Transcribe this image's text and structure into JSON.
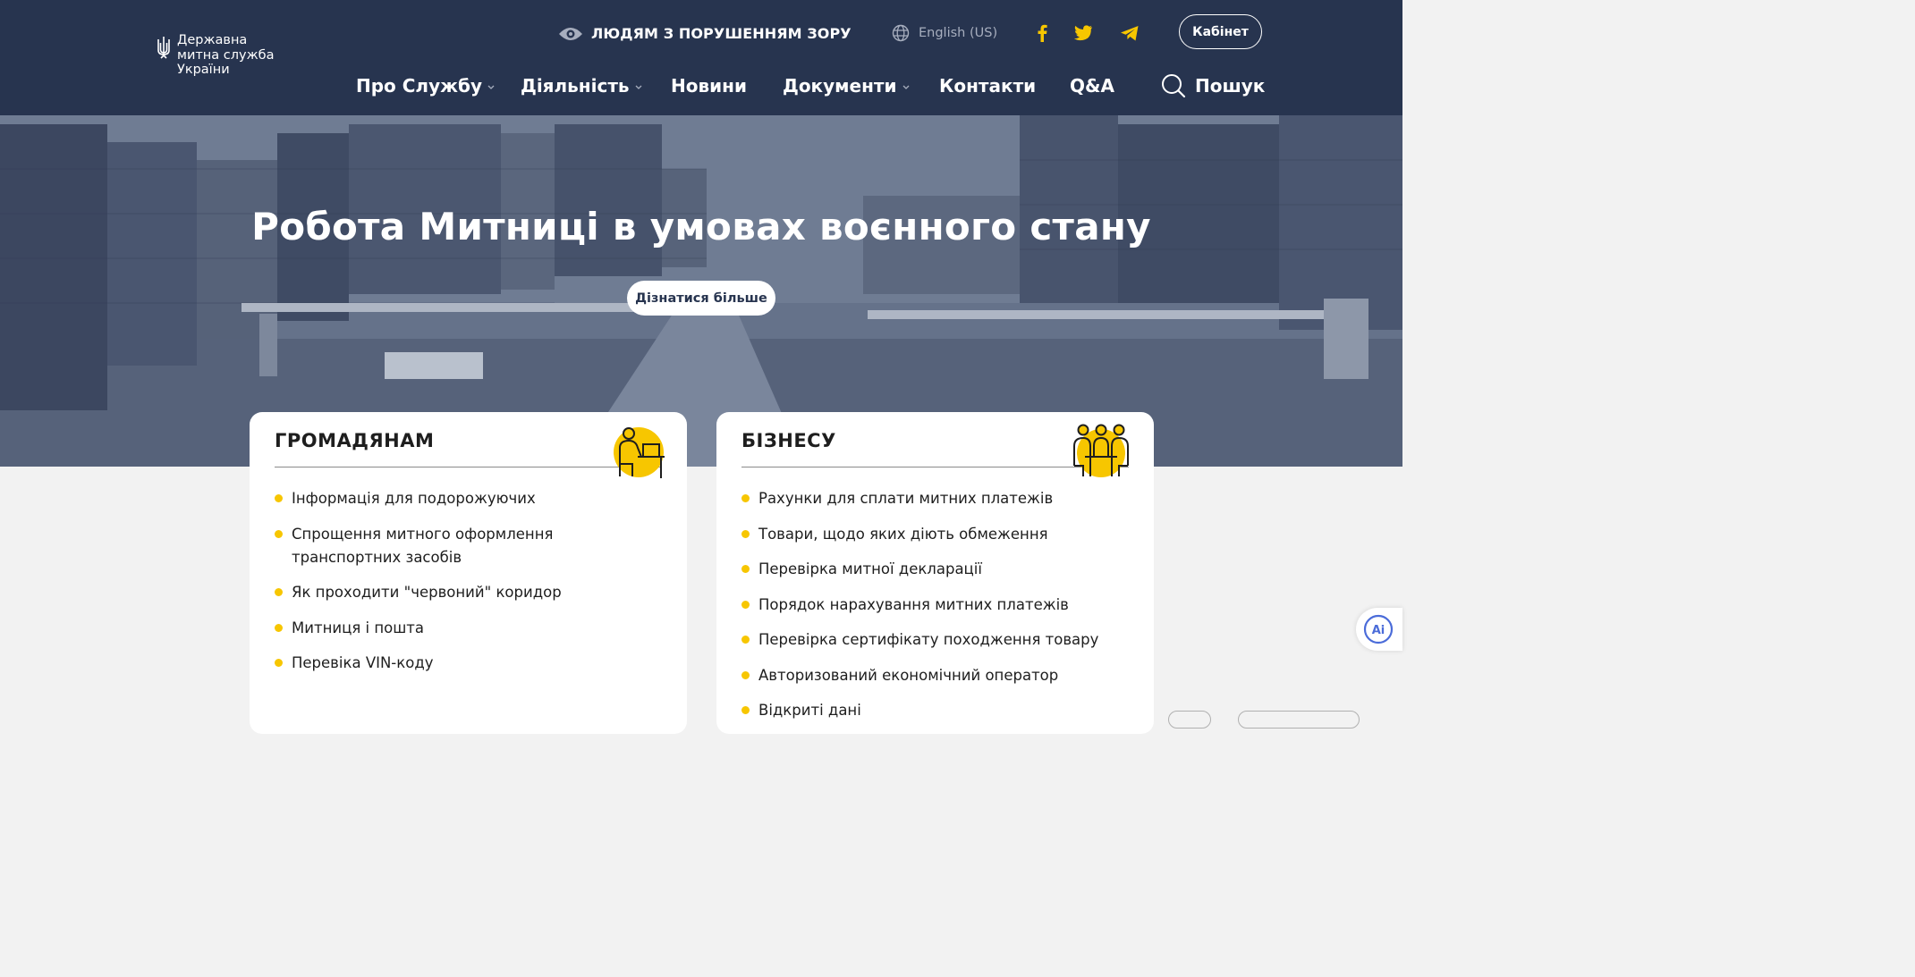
{
  "header": {
    "logo_lines": [
      "Державна",
      "митна служба",
      "України"
    ],
    "vision_label": "ЛЮДЯМ З ПОРУШЕННЯМ ЗОРУ",
    "language": "English (US)",
    "cabinet_label": "Кабінет",
    "nav": [
      {
        "label": "Про Службу",
        "dropdown": true
      },
      {
        "label": "Діяльність",
        "dropdown": true
      },
      {
        "label": "Новини",
        "dropdown": false
      },
      {
        "label": "Документи",
        "dropdown": true
      },
      {
        "label": "Контакти",
        "dropdown": false
      },
      {
        "label": "Q&A",
        "dropdown": false
      }
    ],
    "search_label": "Пошук",
    "social_icons": [
      "facebook-icon",
      "twitter-icon",
      "telegram-icon"
    ]
  },
  "hero": {
    "title": "Робота Митниці в умовах воєнного стану",
    "button_label": "Дізнатися більше"
  },
  "cards": {
    "citizens": {
      "title": "ГРОМАДЯНАМ",
      "icon": "person-at-desk-icon",
      "items": [
        "Інформація для подорожуючих",
        "Спрощення митного оформлення транспортних засобів",
        "Як проходити \"червоний\" коридор",
        "Митниця і пошта",
        "Перевіка VIN-коду"
      ]
    },
    "business": {
      "title": "БІЗНЕСУ",
      "icon": "business-meeting-icon",
      "items": [
        "Рахунки для сплати митних платежів",
        "Товари, щодо яких діють обмеження",
        "Перевірка митної декларації",
        "Порядок нарахування митних платежів",
        "Перевірка сертифікату походження товару",
        "Авторизований економічний оператор",
        "Відкриті дані"
      ]
    }
  },
  "ai_widget_label": "Ai",
  "colors": {
    "header_bg": "#27344f",
    "accent_yellow": "#f7c600",
    "page_bg": "#f2f2f2"
  }
}
